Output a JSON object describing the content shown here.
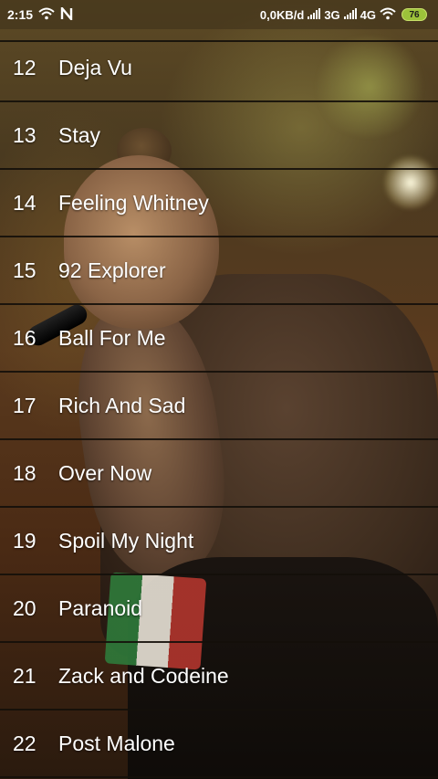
{
  "status_bar": {
    "time": "2:15",
    "network_speed": "0,0KB/d",
    "net_3g": "3G",
    "net_4g": "4G",
    "battery": "76",
    "icons": [
      "wifi-icon",
      "n-notification-icon",
      "signal-icon",
      "wifi-icon",
      "battery-icon"
    ],
    "battery_color": "#9cc23a"
  },
  "tracks": [
    {
      "number": "12",
      "title": "Deja Vu"
    },
    {
      "number": "13",
      "title": "Stay"
    },
    {
      "number": "14",
      "title": "Feeling Whitney"
    },
    {
      "number": "15",
      "title": "92 Explorer"
    },
    {
      "number": "16",
      "title": "Ball For Me"
    },
    {
      "number": "17",
      "title": "Rich And Sad"
    },
    {
      "number": "18",
      "title": "Over Now"
    },
    {
      "number": "19",
      "title": "Spoil My Night"
    },
    {
      "number": "20",
      "title": "Paranoid"
    },
    {
      "number": "21",
      "title": "Zack and Codeine"
    },
    {
      "number": "22",
      "title": "Post Malone"
    }
  ]
}
